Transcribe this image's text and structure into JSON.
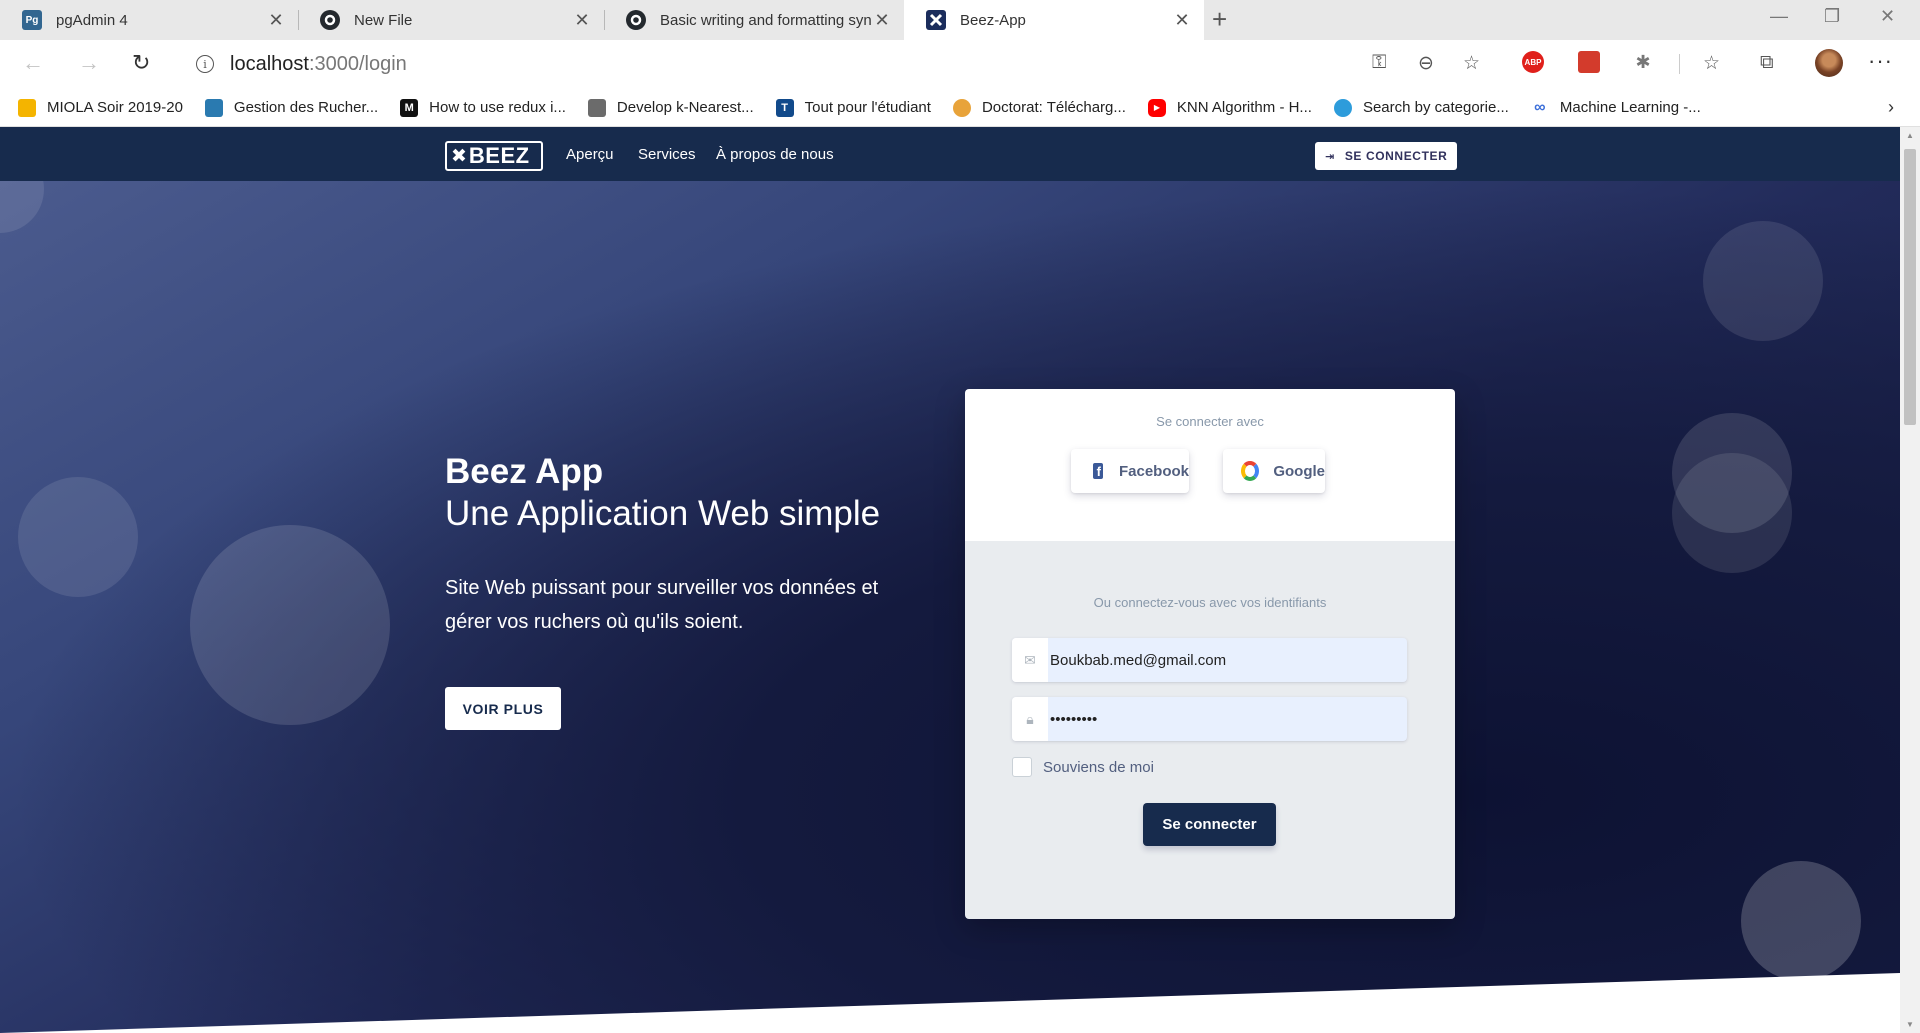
{
  "browser": {
    "tabs": [
      {
        "title": "pgAdmin 4",
        "favicon": "pgadmin-icon",
        "favicon_text": "Pg",
        "favicon_color": "#326690",
        "active": false
      },
      {
        "title": "New File",
        "favicon": "github-icon",
        "active": false
      },
      {
        "title": "Basic writing and formatting synt",
        "favicon": "github-icon",
        "active": false
      },
      {
        "title": "Beez-App",
        "favicon": "beez-icon",
        "active": true
      }
    ],
    "address": {
      "host": "localhost",
      "path": ":3000/login"
    },
    "bookmarks": [
      {
        "label": "MIOLA Soir 2019-20",
        "icon_color": "#f4b400"
      },
      {
        "label": "Gestion des Rucher...",
        "icon_color": "#2a7ab0"
      },
      {
        "label": "How to use redux i...",
        "icon_color": "#111111",
        "icon_text": "M"
      },
      {
        "label": "Develop k-Nearest...",
        "icon_color": "#6b6b6b"
      },
      {
        "label": "Tout pour l'étudiant",
        "icon_color": "#114a8b",
        "icon_text": "T"
      },
      {
        "label": "Doctorat: Télécharg...",
        "icon_color": "#e8a33a"
      },
      {
        "label": "KNN Algorithm - H...",
        "icon_color": "#ff0000"
      },
      {
        "label": "Search by categorie...",
        "icon_color": "#2d9cdb"
      },
      {
        "label": "Machine Learning -...",
        "icon_color": "#3c6fd9"
      }
    ],
    "extensions": [
      {
        "name": "adblock-plus-icon",
        "text": "ABP",
        "color": "#e0201b"
      },
      {
        "name": "red-square-extension-icon",
        "color": "#d33b2c"
      },
      {
        "name": "bug-extension-icon",
        "color": "#777777"
      }
    ]
  },
  "site": {
    "brand": "BEEZ",
    "nav": [
      "Aperçu",
      "Services",
      "À propos de nous"
    ],
    "connect_button": "SE CONNECTER",
    "hero": {
      "title": "Beez App",
      "subtitle": "Une Application Web simple",
      "lead": "Site Web puissant pour surveiller vos données et gérer vos ruchers où qu'ils soient.",
      "more_button": "VOIR PLUS"
    },
    "login": {
      "connect_with": "Se connecter avec",
      "facebook": "Facebook",
      "google": "Google",
      "or_credentials": "Ou connectez-vous avec vos identifiants",
      "email_value": "Boukbab.med@gmail.com",
      "password_value": "•••••••••",
      "remember": "Souviens de moi",
      "submit": "Se connecter"
    }
  },
  "colors": {
    "navbar": "#172b4d",
    "primary": "#172b4d",
    "hero_light": "#4b5b8e",
    "hero_dark": "#121739",
    "autofill": "#e8f0fe"
  }
}
